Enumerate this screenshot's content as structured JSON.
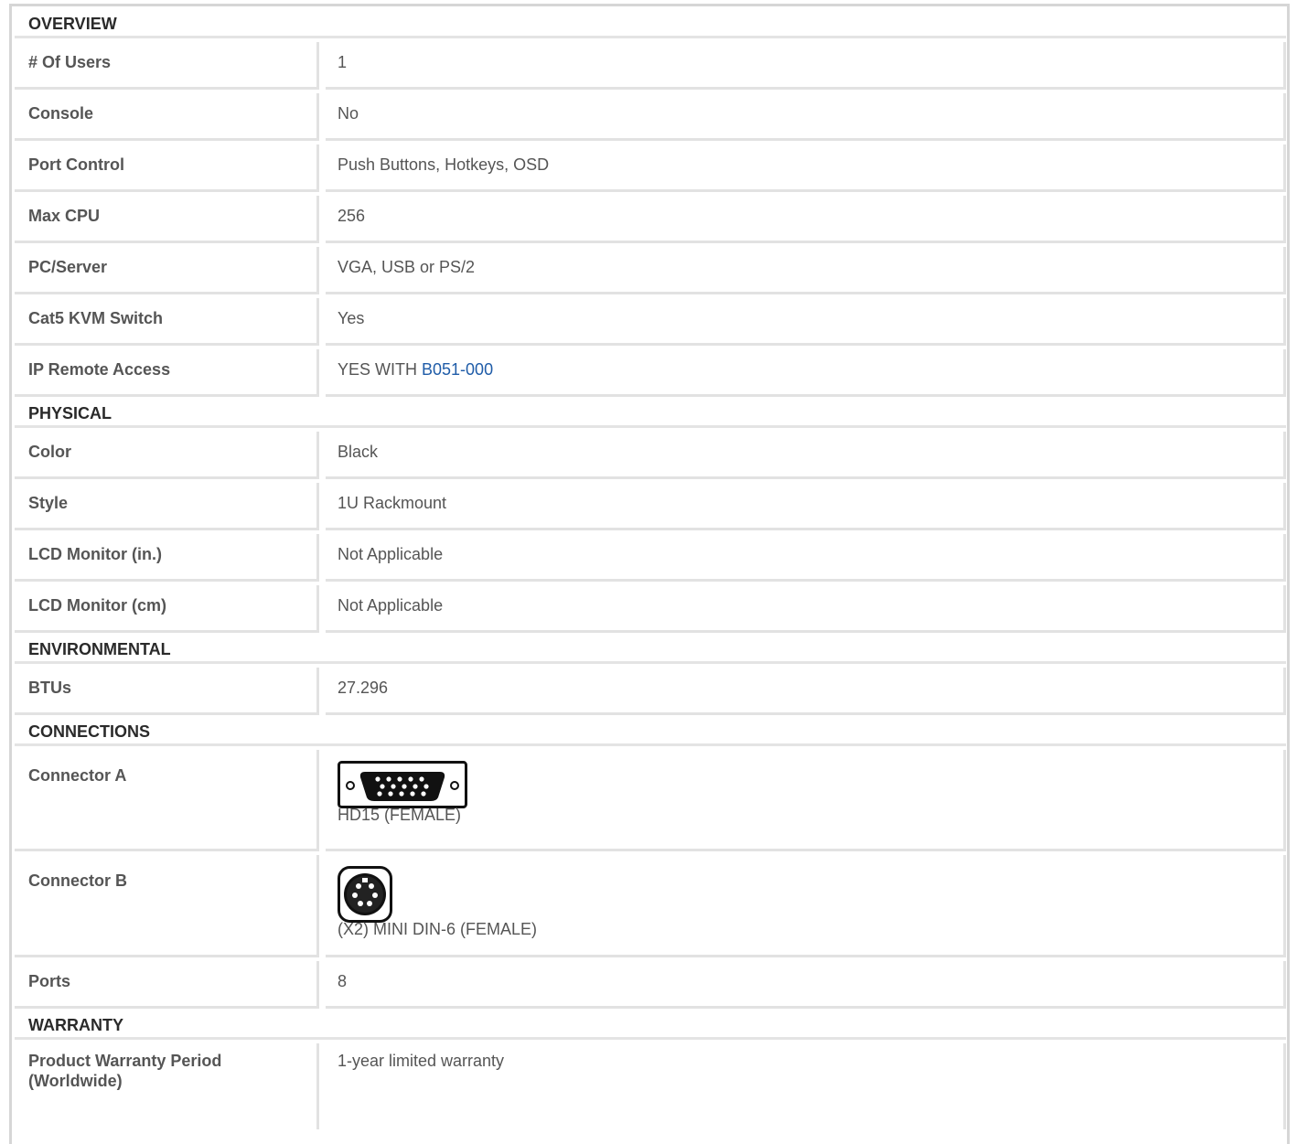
{
  "sections": [
    {
      "title": "OVERVIEW",
      "rows": [
        {
          "label": "# Of Users",
          "value": "1"
        },
        {
          "label": "Console",
          "value": "No"
        },
        {
          "label": "Port Control",
          "value": "Push Buttons, Hotkeys, OSD"
        },
        {
          "label": "Max CPU",
          "value": "256"
        },
        {
          "label": "PC/Server",
          "value": "VGA, USB or PS/2"
        },
        {
          "label": "Cat5 KVM Switch",
          "value": "Yes"
        },
        {
          "label": "IP Remote Access",
          "value_prefix": "YES WITH ",
          "value_link": "B051-000"
        }
      ]
    },
    {
      "title": "PHYSICAL",
      "rows": [
        {
          "label": "Color",
          "value": "Black"
        },
        {
          "label": "Style",
          "value": "1U Rackmount"
        },
        {
          "label": "LCD Monitor (in.)",
          "value": "Not Applicable"
        },
        {
          "label": "LCD Monitor (cm)",
          "value": "Not Applicable"
        }
      ]
    },
    {
      "title": "ENVIRONMENTAL",
      "rows": [
        {
          "label": "BTUs",
          "value": "27.296"
        }
      ]
    },
    {
      "title": "CONNECTIONS",
      "rows": [
        {
          "label": "Connector A",
          "value": "HD15 (FEMALE)",
          "icon": "hd15-connector-icon"
        },
        {
          "label": "Connector B",
          "value": "(X2) MINI DIN-6 (FEMALE)",
          "icon": "mini-din6-connector-icon"
        },
        {
          "label": "Ports",
          "value": "8"
        }
      ]
    },
    {
      "title": "WARRANTY",
      "rows": [
        {
          "label": "Product Warranty Period (Worldwide)",
          "value": "1-year limited warranty"
        }
      ]
    }
  ],
  "colors": {
    "link": "#1f5ca8",
    "text": "#555555",
    "header_text": "#2a2a2a",
    "border": "#e2e2e2"
  }
}
